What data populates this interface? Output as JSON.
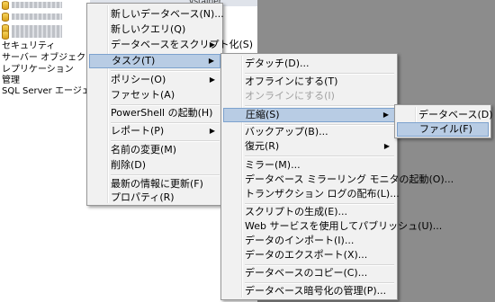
{
  "tree": {
    "obscured_label": "",
    "nodes": [
      "セキュリティ",
      "サーバー オブジェクト",
      "レプリケーション",
      "管理",
      "SQL Server エージェント"
    ]
  },
  "right_pane": {
    "tab_text": "vstainer"
  },
  "menu_main": {
    "items": [
      {
        "label": "新しいデータベース(N)..."
      },
      {
        "label": "新しいクエリ(Q)"
      },
      {
        "label": "データベースをスクリプト化(S)"
      },
      {
        "label": "タスク(T)"
      },
      {
        "label": "ポリシー(O)"
      },
      {
        "label": "ファセット(A)"
      },
      {
        "label": "PowerShell の起動(H)"
      },
      {
        "label": "レポート(P)"
      },
      {
        "label": "名前の変更(M)"
      },
      {
        "label": "削除(D)"
      },
      {
        "label": "最新の情報に更新(F)"
      },
      {
        "label": "プロパティ(R)"
      }
    ]
  },
  "menu_tasks": {
    "items": [
      {
        "label": "デタッチ(D)..."
      },
      {
        "label": "オフラインにする(T)"
      },
      {
        "label": "オンラインにする(I)"
      },
      {
        "label": "圧縮(S)"
      },
      {
        "label": "バックアップ(B)..."
      },
      {
        "label": "復元(R)"
      },
      {
        "label": "ミラー(M)..."
      },
      {
        "label": "データベース ミラーリング モニタの起動(O)..."
      },
      {
        "label": "トランザクション ログの配布(L)..."
      },
      {
        "label": "スクリプトの生成(E)..."
      },
      {
        "label": "Web サービスを使用してパブリッシュ(U)..."
      },
      {
        "label": "データのインポート(I)..."
      },
      {
        "label": "データのエクスポート(X)..."
      },
      {
        "label": "データベースのコピー(C)..."
      },
      {
        "label": "データベース暗号化の管理(P)..."
      }
    ]
  },
  "menu_shrink": {
    "items": [
      {
        "label": "データベース(D)"
      },
      {
        "label": "ファイル(F)"
      }
    ]
  },
  "colors": {
    "highlight": "#b8cce4",
    "highlight_border": "#7da2ce",
    "menu_bg": "#f1f1f1"
  }
}
